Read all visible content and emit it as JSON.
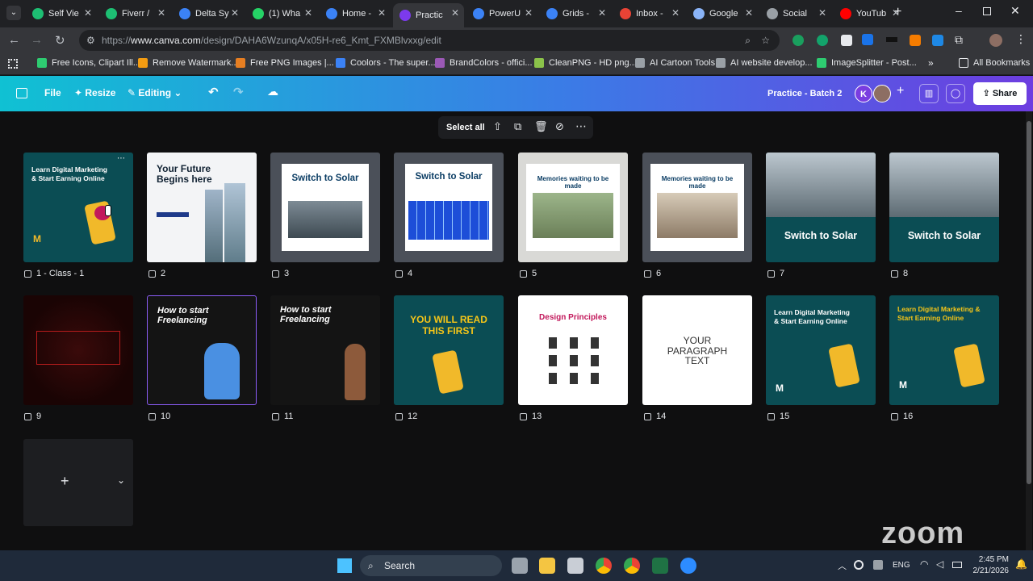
{
  "tabs": [
    {
      "label": "Self Vie",
      "color": "#1dbf73"
    },
    {
      "label": "Fiverr /",
      "color": "#1dbf73"
    },
    {
      "label": "Delta Sy",
      "color": "#3b82f6"
    },
    {
      "label": "(1) Wha",
      "color": "#25d366"
    },
    {
      "label": "Home -",
      "color": "#3b82f6"
    },
    {
      "label": "Practic",
      "color": "#7c3aed"
    },
    {
      "label": "PowerU",
      "color": "#3b82f6"
    },
    {
      "label": "Grids -",
      "color": "#3b82f6"
    },
    {
      "label": "Inbox -",
      "color": "#ea4335"
    },
    {
      "label": "Google",
      "color": "#8ab4f8"
    },
    {
      "label": "Social",
      "color": "#9aa0a6"
    },
    {
      "label": "YouTub",
      "color": "#ff0000"
    }
  ],
  "url": {
    "prefix": "https://",
    "host": "www.canva.com",
    "path": "/design/DAHA6WzunqA/x05H-re6_Kmt_FXMBlvxxg/edit"
  },
  "bookmarks": [
    {
      "label": "Free Icons, Clipart Ill...",
      "color": "#2ecc71"
    },
    {
      "label": "Remove Watermark...",
      "color": "#f39c12"
    },
    {
      "label": "Free PNG Images |...",
      "color": "#e67e22"
    },
    {
      "label": "Coolors - The super...",
      "color": "#3b82f6"
    },
    {
      "label": "BrandColors - offici...",
      "color": "#9b59b6"
    },
    {
      "label": "CleanPNG - HD png...",
      "color": "#8bc34a"
    },
    {
      "label": "AI Cartoon Tools",
      "color": "#9aa0a6"
    },
    {
      "label": "AI website develop...",
      "color": "#9aa0a6"
    },
    {
      "label": "ImageSplitter - Post...",
      "color": "#2ecc71"
    }
  ],
  "all_bookmarks": "All Bookmarks",
  "canva": {
    "file": "File",
    "resize": "Resize",
    "editing": "Editing",
    "title": "Practice - Batch 2",
    "avatar": "K",
    "share": "Share"
  },
  "toolbar": {
    "select_all": "Select all"
  },
  "pages": [
    {
      "label": "1 - Class - 1",
      "title": "Learn Digital Marketing & Start Earning Online"
    },
    {
      "label": "2",
      "title": "Your Future Begins here"
    },
    {
      "label": "3",
      "title": "Switch to Solar"
    },
    {
      "label": "4",
      "title": "Switch to Solar"
    },
    {
      "label": "5",
      "title": "Memories waiting to be made"
    },
    {
      "label": "6",
      "title": "Memories waiting to be made"
    },
    {
      "label": "7",
      "title": "Switch to Solar"
    },
    {
      "label": "8",
      "title": "Switch to Solar"
    },
    {
      "label": "9",
      "title": ""
    },
    {
      "label": "10",
      "title": "How to start Freelancing"
    },
    {
      "label": "11",
      "title": "How to start Freelancing"
    },
    {
      "label": "12",
      "title": "YOU WILL READ THIS FIRST"
    },
    {
      "label": "13",
      "title": "Design Principles"
    },
    {
      "label": "14",
      "title": "YOUR PARAGRAPH TEXT"
    },
    {
      "label": "15",
      "title": "Learn Digital Marketing & Start Earning Online"
    },
    {
      "label": "16",
      "title": "Learn Digital Marketing & Start Earning Online"
    }
  ],
  "taskbar": {
    "search": "Search",
    "lang": "ENG",
    "time": "2:45 PM",
    "date": "2/21/2026"
  },
  "watermark": "zoom"
}
